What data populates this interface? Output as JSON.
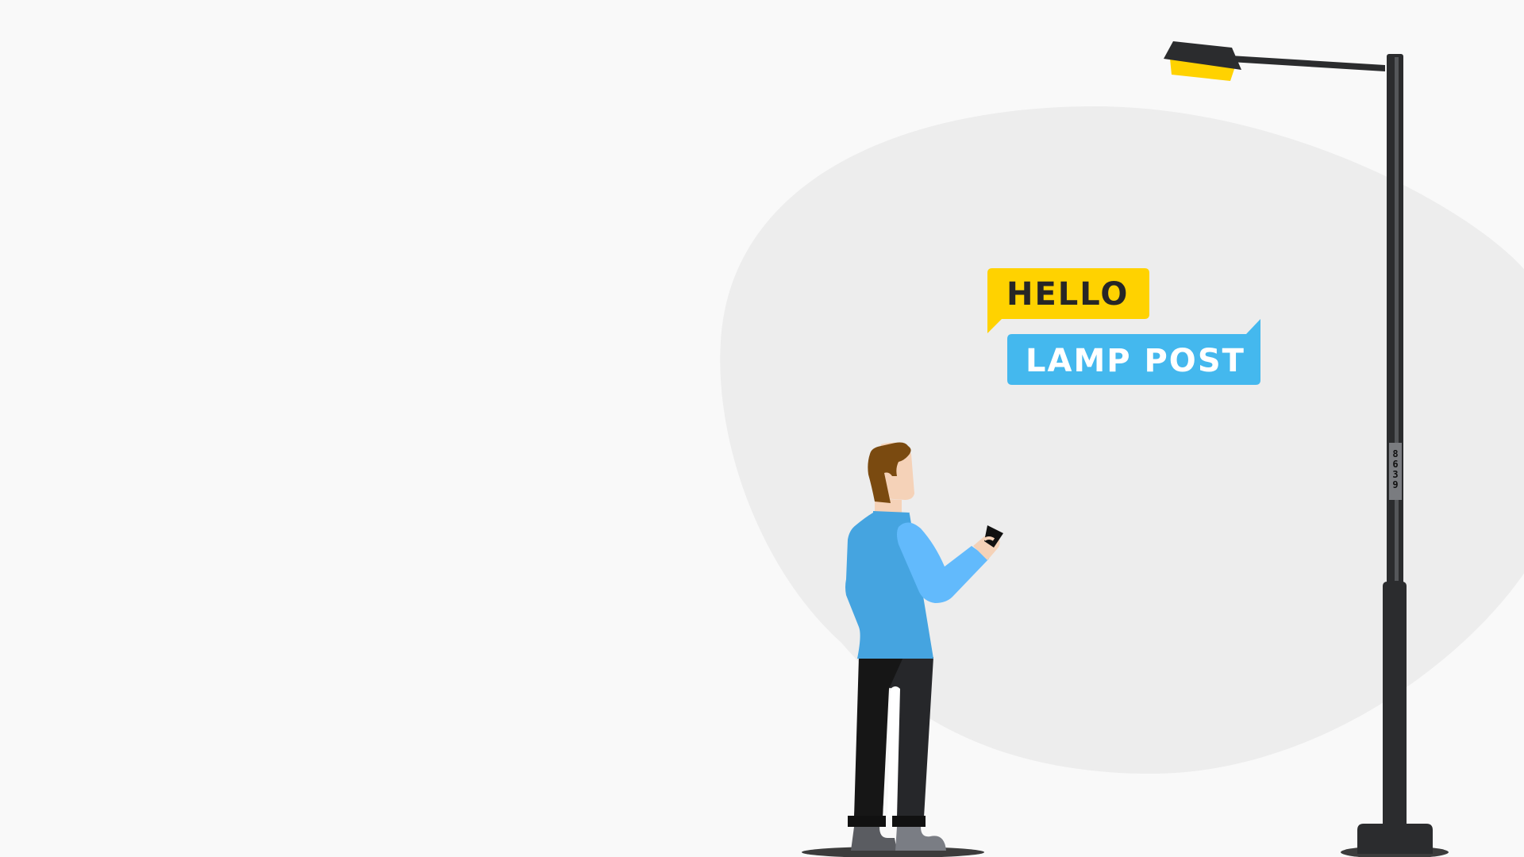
{
  "speech": {
    "hello": "HELLO",
    "lamp_post": "LAMP POST"
  },
  "lamp_post": {
    "id_digits": [
      "8",
      "6",
      "3",
      "9"
    ]
  },
  "colors": {
    "background": "#f9f9f9",
    "blob": "#ededed",
    "hello_bubble": "#ffd200",
    "hello_text": "#262626",
    "lamp_bubble": "#44b8ee",
    "lamp_text": "#ffffff",
    "pole": "#2b2c2e",
    "lamp_light": "#ffd200",
    "shirt": "#45a4e0",
    "sleeve": "#62bafc",
    "trousers": "#1a1a1a",
    "hair": "#7a4a10",
    "skin": "#f5d2b8"
  }
}
